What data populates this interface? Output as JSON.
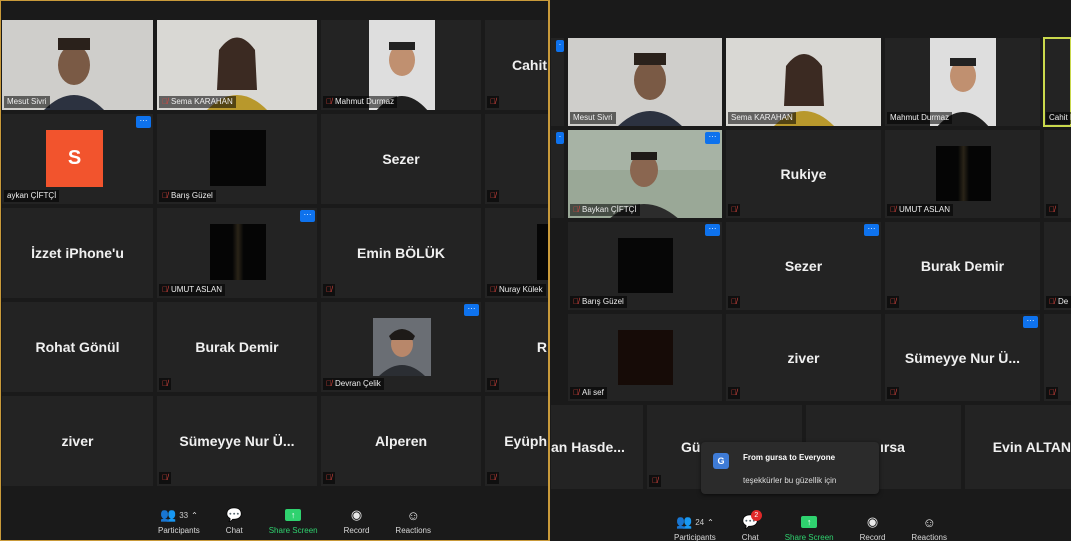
{
  "left": {
    "tiles": {
      "mesut": "Mesut Sivri",
      "sema": "Sema KARAHAN",
      "mahmut": "Mahmut Durmaz",
      "cahit": "Cahit",
      "avatar_letter": "S",
      "baykan": "aykan ÇİFTÇİ",
      "baris": "Barış Güzel",
      "sezer": "Sezer",
      "izzet": "İzzet iPhone'u",
      "umut": "UMUT ASLAN",
      "emin": "Emin BÖLÜK",
      "nuray": "Nuray Külek",
      "rohat": "Rohat Gönül",
      "burak": "Burak Demir",
      "devran": "Devran Çelik",
      "r_partial": "R",
      "ziver": "ziver",
      "sumeyye": "Sümeyye Nur Ü...",
      "alperen": "Alperen",
      "eyup": "Eyüph"
    },
    "toolbar": {
      "participants": "Participants",
      "participants_count": "33",
      "chat": "Chat",
      "share": "Share Screen",
      "record": "Record",
      "reactions": "Reactions"
    }
  },
  "right": {
    "tiles": {
      "mesut": "Mesut Sivri",
      "sema": "Sema KARAHAN",
      "mahmut": "Mahmut Durmaz",
      "cahit": "Cahit I",
      "baykan": "Baykan ÇİFTÇİ",
      "rukiye": "Rukiye",
      "umut": "UMUT ASLAN",
      "baris": "Barış Güzel",
      "sezer": "Sezer",
      "burak": "Burak Demir",
      "dev": "De",
      "ali": "Ali sef",
      "ziver": "ziver",
      "sumeyye": "Sümeyye Nur Ü...",
      "hasde": "an Hasde...",
      "gu": "Gü",
      "gursa": "ırsa",
      "evin": "Evin ALTAN"
    },
    "toolbar": {
      "participants": "Participants",
      "participants_count": "24",
      "chat": "Chat",
      "chat_badge": "2",
      "share": "Share Screen",
      "record": "Record",
      "reactions": "Reactions"
    },
    "chat_popup": {
      "avatar": "G",
      "from": "From gursa to Everyone",
      "message": "teşekkürler bu güzellik için"
    }
  },
  "colors": {
    "accent": "#0e72ed",
    "share_green": "#2fd26f",
    "muted_red": "#e0463f",
    "badge_red": "#e02828"
  }
}
